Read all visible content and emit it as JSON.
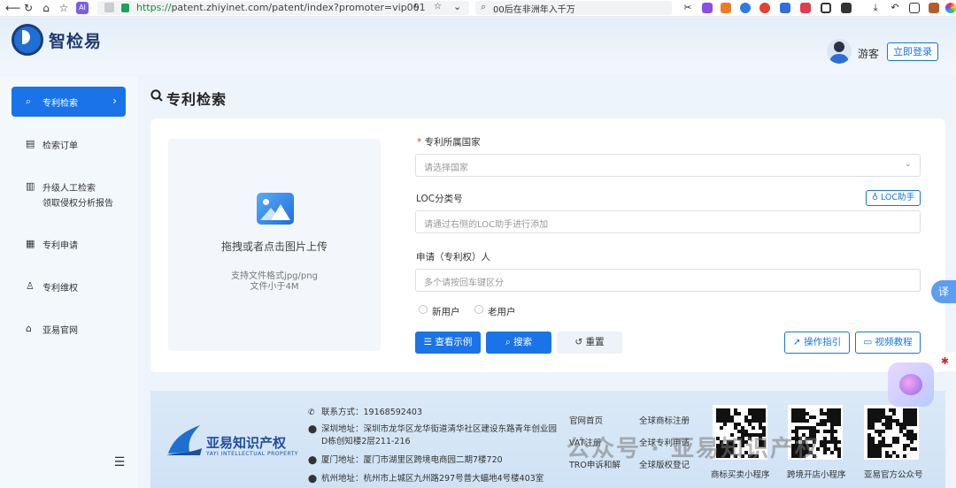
{
  "browser": {
    "url_scheme": "https://",
    "url_rest": "patent.zhiyinet.com/patent/index?promoter=vip001",
    "search_text": "00后在非洲年入千万"
  },
  "header": {
    "brand": "智检易",
    "guest": "游客",
    "login": "立即登录"
  },
  "sidebar": {
    "items": [
      {
        "label": "专利检索"
      },
      {
        "label": "检索订单"
      },
      {
        "label": "升级人工检索",
        "label2": "领取侵权分析报告"
      },
      {
        "label": "专利申请"
      },
      {
        "label": "专利维权"
      },
      {
        "label": "亚易官网"
      }
    ]
  },
  "page": {
    "title": "专利检索"
  },
  "upload": {
    "text": "拖拽或者点击图片上传",
    "hint1": "支持文件格式jpg/png",
    "hint2": "文件小于4M"
  },
  "form": {
    "country_label": "专利所属国家",
    "country_required": "*",
    "country_placeholder": "请选择国家",
    "loc_label": "LOC分类号",
    "loc_helper": "LOC助手",
    "loc_placeholder": "请通过右侧的LOC助手进行添加",
    "applicant_label": "申请（专利权）人",
    "applicant_placeholder": "多个请按回车键区分",
    "radio_new": "新用户",
    "radio_old": "老用户",
    "btn_example": "查看示例",
    "btn_search": "搜索",
    "btn_reset": "重置",
    "btn_guide": "操作指引",
    "btn_video": "视频教程"
  },
  "footer": {
    "brand": "亚易知识产权",
    "brand_en": "YAYI INTELLECTUAL PROPERTY",
    "contact": "联系方式：19168592403",
    "shenzhen_1": "深圳地址：深圳市龙华区龙华街道清华社区建设东路青年创业园",
    "shenzhen_2": "D栋创知楼2层211-216",
    "xiamen": "厦门地址：厦门市湖里区跨境电商园二期7楼720",
    "hangzhou": "杭州地址：杭州市上城区九州路297号普大蝠地4号楼403室",
    "links": [
      "官网首页",
      "全球商标注册",
      "VAT注册",
      "全球专利申请",
      "TRO申诉和解",
      "全球版权登记"
    ],
    "qr_labels": [
      "商标买卖小程序",
      "跨境开店小程序",
      "亚易官方公众号"
    ],
    "watermark": "公众号 · 亚易知识产权"
  },
  "floating": {
    "translate": "译"
  },
  "colors": {
    "accent": "#1a73e8",
    "sidebar_active": "#1a73e8",
    "brand_dark": "#1d3a6e"
  }
}
